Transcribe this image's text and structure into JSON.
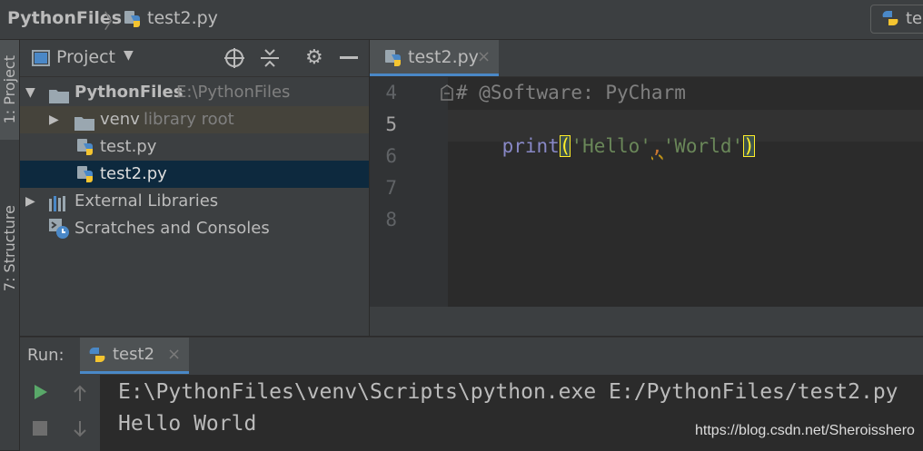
{
  "breadcrumb": {
    "project": "PythonFiles",
    "file": "test2.py"
  },
  "run_config": {
    "label": "te"
  },
  "tool_strip": {
    "project_tab": "1: Project",
    "structure_tab": "7: Structure"
  },
  "project_panel": {
    "view_selector": "Project",
    "tree": [
      {
        "label": "PythonFiles",
        "hint": "E:\\PythonFiles",
        "type": "folder"
      },
      {
        "label": "venv",
        "hint": "library root",
        "type": "folder"
      },
      {
        "label": "test.py",
        "hint": "",
        "type": "python-file"
      },
      {
        "label": "test2.py",
        "hint": "",
        "type": "python-file",
        "selected": true
      },
      {
        "label": "External Libraries",
        "hint": "",
        "type": "libraries"
      },
      {
        "label": "Scratches and Consoles",
        "hint": "",
        "type": "scratches"
      }
    ]
  },
  "editor": {
    "tab_label": "test2.py",
    "line_numbers": [
      "4",
      "5",
      "6",
      "7",
      "8"
    ],
    "comment_line": "# @Software: PyCharm",
    "code": {
      "func": "print",
      "open_paren": "(",
      "str1": "'Hello'",
      "comma": ",",
      "str2": "'World'",
      "close_paren": ")"
    }
  },
  "run_panel": {
    "title": "Run:",
    "tab_label": "test2",
    "output": [
      "E:\\PythonFiles\\venv\\Scripts\\python.exe E:/PythonFiles/test2.py",
      "Hello World"
    ]
  },
  "watermark": "https://blog.csdn.net/Sheroisshero",
  "colors": {
    "accent": "#4a88c7",
    "selection": "#0d293e",
    "panel": "#3c3f41",
    "editor_bg": "#2b2b2b"
  }
}
